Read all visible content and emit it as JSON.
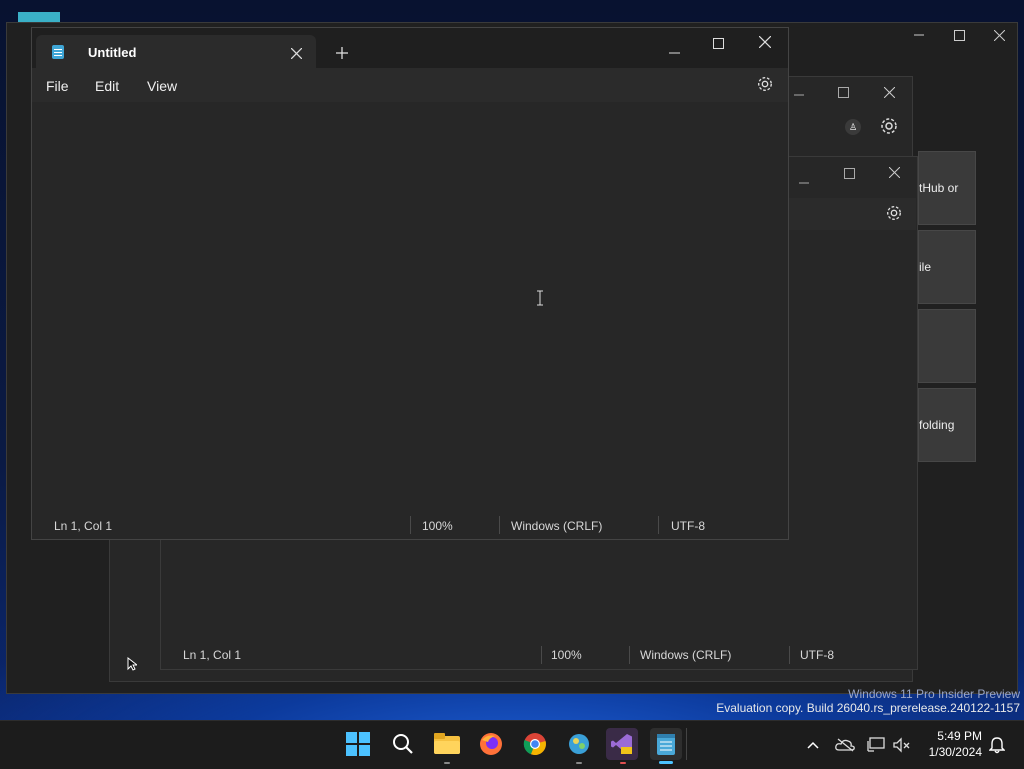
{
  "top_window": {
    "tab_title": "Untitled",
    "menu": [
      "File",
      "Edit",
      "View"
    ],
    "status": {
      "position": "Ln 1, Col 1",
      "zoom": "100%",
      "line_ending": "Windows (CRLF)",
      "encoding": "UTF-8"
    }
  },
  "back_window": {
    "status": {
      "position": "Ln 1, Col 1",
      "zoom": "100%",
      "line_ending": "Windows (CRLF)",
      "encoding": "UTF-8"
    }
  },
  "side_panel": {
    "cards": [
      "tHub or",
      "ile",
      "",
      "folding"
    ]
  },
  "watermark": {
    "line1": "Windows 11 Pro Insider Preview",
    "line2": "Evaluation copy. Build 26040.rs_prerelease.240122-1157"
  },
  "taskbar": {
    "time": "5:49 PM",
    "date": "1/30/2024"
  }
}
